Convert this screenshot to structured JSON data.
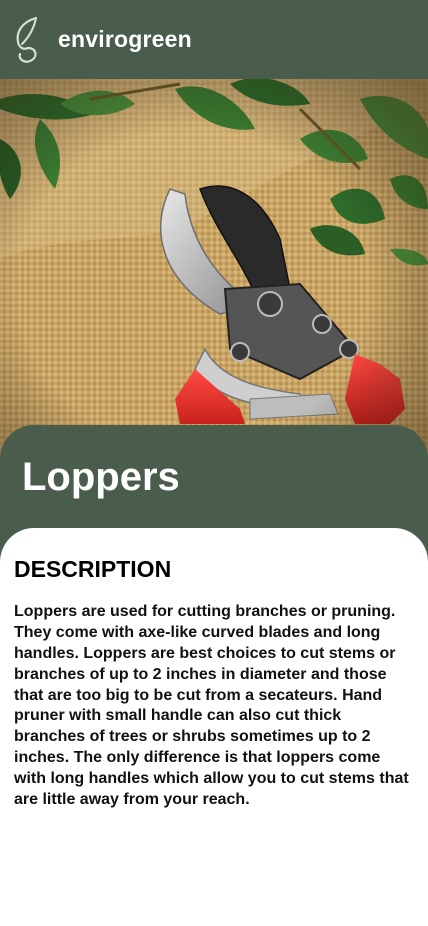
{
  "header": {
    "brand_name": "envirogreen",
    "logo_icon": "leaf-logo-icon",
    "background_color": "#4a5d4c"
  },
  "hero": {
    "image": "pruning-shears-on-burlap-photo"
  },
  "product": {
    "title": "Loppers"
  },
  "description": {
    "heading": "DESCRIPTION",
    "body": "Loppers are used for cutting branches or pruning. They come with axe-like curved blades and long handles. Loppers are best choices to cut stems or branches of up to 2 inches in diameter and those that are too big to be cut from a secateurs. Hand pruner with small handle can also cut thick branches of trees or shrubs sometimes up to 2 inches. The only difference is that loppers come with long handles which allow you to cut stems that are little away from your reach."
  },
  "colors": {
    "brand_green": "#4a5d4c",
    "handle_red": "#e8332e",
    "text": "#111111"
  }
}
